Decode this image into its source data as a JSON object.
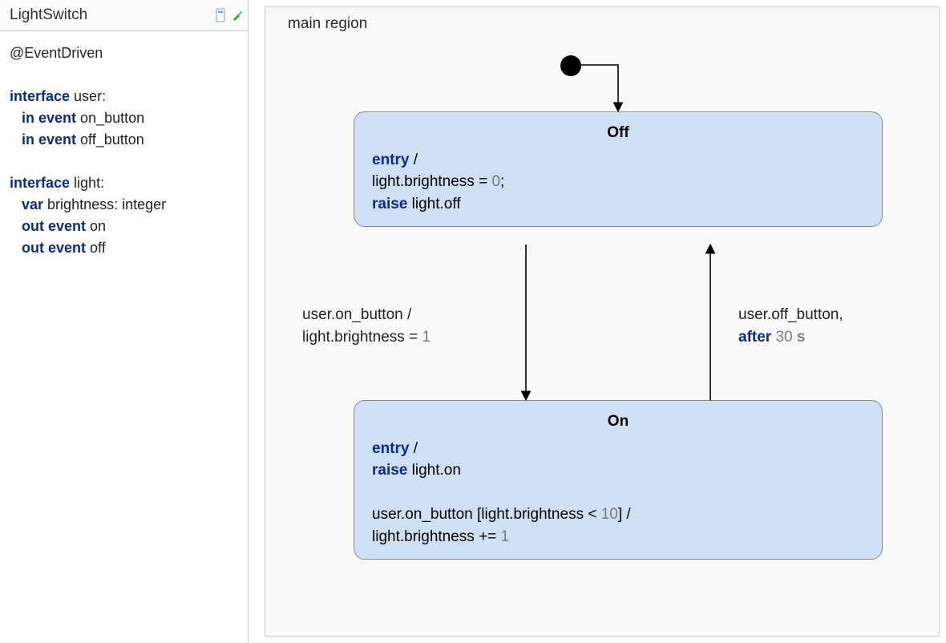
{
  "sidebar": {
    "title": "LightSwitch",
    "definition": {
      "annotation": "@EventDriven",
      "iface_user": "interface",
      "iface_user_name": " user:",
      "in_kw": "in event",
      "on_button": " on_button",
      "off_button": " off_button",
      "iface_light": "interface",
      "iface_light_name": " light:",
      "var_kw": "var",
      "brightness_decl": " brightness: integer",
      "out_kw": "out event",
      "on_evt": " on",
      "off_evt": " off"
    }
  },
  "region": {
    "title": "main region",
    "states": {
      "off": {
        "title": "Off",
        "entry_kw": "entry",
        "slash": " /",
        "line1_pre": "light.brightness = ",
        "line1_num": "0",
        "line1_post": ";",
        "raise_kw": "raise",
        "raise_rest": " light.off"
      },
      "on": {
        "title": "On",
        "entry_kw": "entry",
        "slash": " /",
        "raise_kw": "raise",
        "raise_rest": " light.on",
        "int_line1_pre": "user.on_button [light.brightness < ",
        "int_line1_num": "10",
        "int_line1_post": "] /",
        "int_line2_pre": "light.brightness += ",
        "int_line2_num": "1"
      }
    },
    "transitions": {
      "off_to_on": {
        "line1": "user.on_button /",
        "line2_pre": "light.brightness = ",
        "line2_num": "1"
      },
      "on_to_off": {
        "line1": "user.off_button,",
        "after_kw": "after",
        "after_num": " 30",
        "after_unit": " s"
      }
    }
  }
}
